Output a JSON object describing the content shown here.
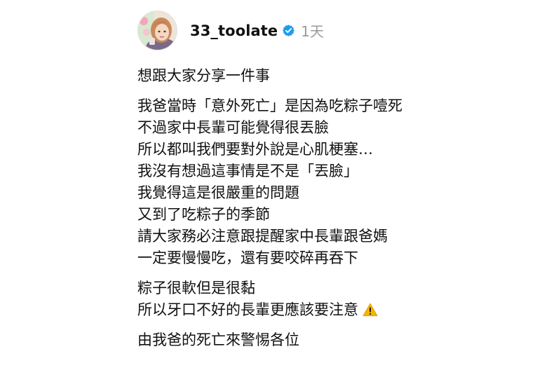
{
  "post": {
    "username": "33_toolate",
    "time": "1天",
    "verified_icon": "verified-badge-icon",
    "paragraphs": [
      {
        "lines": [
          "想跟大家分享一件事"
        ]
      },
      {
        "lines": [
          "我爸當時「意外死亡」是因為吃粽子噎死",
          "不過家中長輩可能覺得很丟臉",
          "所以都叫我們要對外說是心肌梗塞…",
          "我沒有想過這事情是不是「丟臉」",
          "我覺得這是很嚴重的問題",
          "又到了吃粽子的季節",
          "請大家務必注意跟提醒家中長輩跟爸媽",
          "一定要慢慢吃，還有要咬碎再吞下"
        ]
      },
      {
        "lines": [
          "粽子很軟但是很黏",
          "所以牙口不好的長輩更應該要注意"
        ]
      },
      {
        "lines": [
          "由我爸的死亡來警惕各位"
        ]
      }
    ],
    "warning_icon": "warning-icon"
  },
  "colors": {
    "verified": "#1d9bf0",
    "time": "#9a9a9a",
    "warning": "#f5b400"
  }
}
